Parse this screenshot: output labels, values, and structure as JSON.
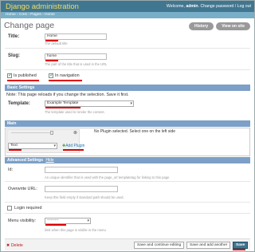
{
  "header": {
    "brand": "Django administration",
    "welcome": "Welcome,",
    "user": "admin",
    "change_password": "Change password",
    "separator": "/",
    "logout": "Log out"
  },
  "breadcrumb": "Home › Cms › Pages › Home",
  "page_title": "Change page",
  "object_tools": {
    "history": "History",
    "view_on_site": "View on site"
  },
  "fields": {
    "title": {
      "label": "Title:",
      "value": "Home",
      "help": "The default title"
    },
    "slug": {
      "label": "Slug:",
      "value": "home",
      "help": "The part of the title that is used in the URL"
    },
    "is_published": {
      "label": "Is published",
      "checked": true
    },
    "in_navigation": {
      "label": "In navigation",
      "checked": true
    }
  },
  "basic_settings": {
    "heading": "Basic Settings",
    "note": "Note: This page reloads if you change the selection. Save it first.",
    "template_label": "Template:",
    "template_value": "Example Template",
    "template_help": "The template used to render the content."
  },
  "main": {
    "heading": "Main",
    "no_plugin": "No Plugin selected. Select one on the left side",
    "plugin_type": "Text",
    "add_plugin": "Add Plugin",
    "close_icon": "close-icon"
  },
  "advanced": {
    "heading": "Advanced Settings",
    "toggle": "Hide",
    "id_label": "Id:",
    "id_help": "An unique identifier that is used with the page_url templatetag for linking to this page",
    "overwrite_label": "Overwrite URL:",
    "overwrite_help": "Keep this field empty if standard path should be used.",
    "login_required": "Login required",
    "menu_visibility_label": "Menu visibility:",
    "menu_visibility_value": "---------",
    "menu_visibility_help": "limit when this page is visible in the menu"
  },
  "footer": {
    "delete": "Delete",
    "save_continue": "Save and continue editing",
    "save_add": "Save and add another",
    "save": "Save"
  },
  "colors": {
    "header": "#417690",
    "breadcrumb": "#79aec8",
    "section": "#7ca0c7",
    "highlight": "#e00000"
  }
}
